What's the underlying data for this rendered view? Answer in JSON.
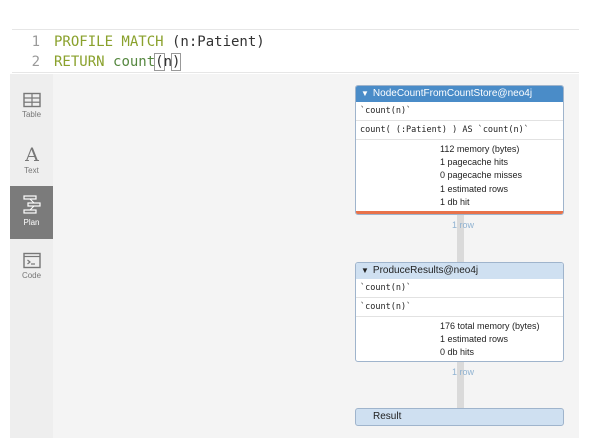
{
  "editor": {
    "line1": {
      "num": "1",
      "kw1": "PROFILE MATCH",
      "rest": " (n:Patient)"
    },
    "line2": {
      "num": "2",
      "kw": "RETURN",
      "fn": "count",
      "open": "(",
      "arg": "n",
      "close": ")"
    }
  },
  "sidebar": {
    "items": [
      {
        "label": "Table",
        "icon": "table-icon"
      },
      {
        "label": "Text",
        "icon": "text-icon"
      },
      {
        "label": "Plan",
        "icon": "plan-icon",
        "active": true
      },
      {
        "label": "Code",
        "icon": "code-icon"
      }
    ]
  },
  "plan": {
    "op1": {
      "title": "NodeCountFromCountStore@neo4j",
      "rows": [
        "`count(n)`",
        "count( (:Patient) ) AS `count(n)`"
      ],
      "stats": [
        "112 memory (bytes)",
        "1 pagecache hits",
        "0 pagecache misses",
        "1 estimated rows",
        "1 db hit"
      ]
    },
    "edge1": "1 row",
    "op2": {
      "title": "ProduceResults@neo4j",
      "rows": [
        "`count(n)`",
        "`count(n)`"
      ],
      "stats": [
        "176 total memory (bytes)",
        "1 estimated rows",
        "0 db hits"
      ]
    },
    "edge2": "1 row",
    "result": "Result"
  },
  "colors": {
    "op_header_active": "#4a8cc8",
    "op_header": "#cfe0f1",
    "accent_bar": "#e8724a",
    "keyword": "#8aa12c"
  }
}
